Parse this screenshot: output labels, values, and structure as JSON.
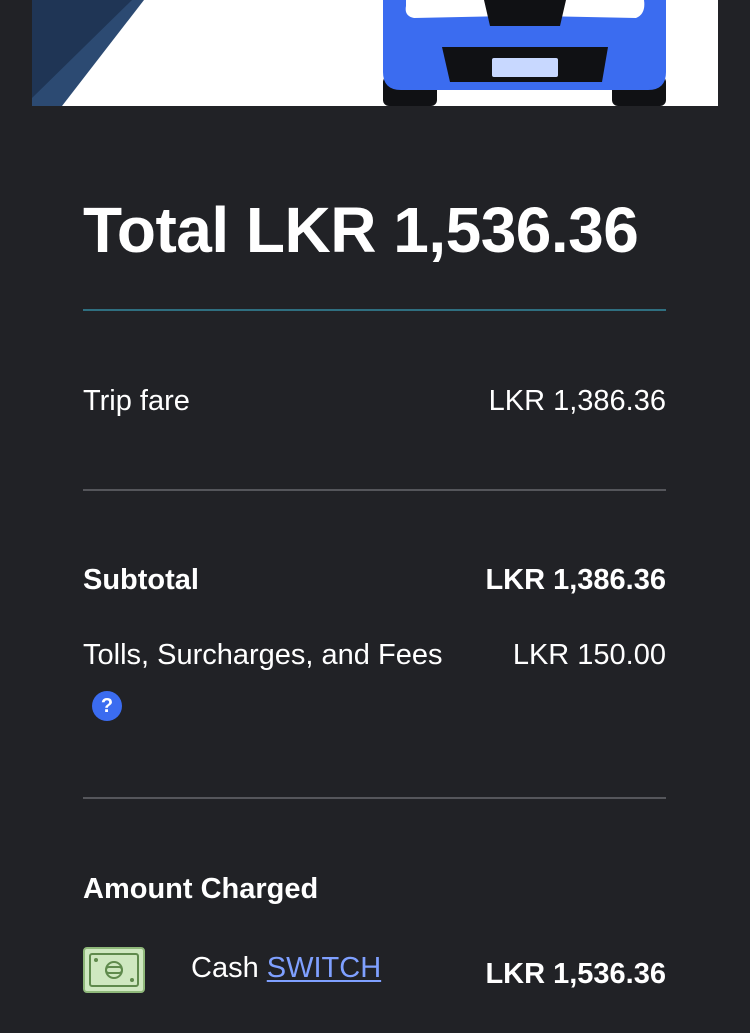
{
  "receipt": {
    "total_label": "Total LKR 1,536.36",
    "trip_fare": {
      "label": "Trip fare",
      "value": "LKR 1,386.36"
    },
    "subtotal": {
      "label": "Subtotal",
      "value": "LKR 1,386.36"
    },
    "fees": {
      "label": "Tolls, Surcharges, and Fees",
      "value": "LKR 150.00",
      "help_glyph": "?"
    },
    "amount_charged": {
      "title": "Amount Charged",
      "method": "Cash",
      "switch_label": "SWITCH",
      "value": "LKR 1,536.36"
    }
  },
  "icons": {
    "hero": "car-illustration",
    "help": "question-circle-icon",
    "cash": "cash-bill-icon"
  },
  "colors": {
    "background": "#212226",
    "car_blue": "#3b6cf0",
    "link": "#7fa0ff",
    "accent_rule": "#2f6f80",
    "cash_green": "#cfe8c0"
  }
}
